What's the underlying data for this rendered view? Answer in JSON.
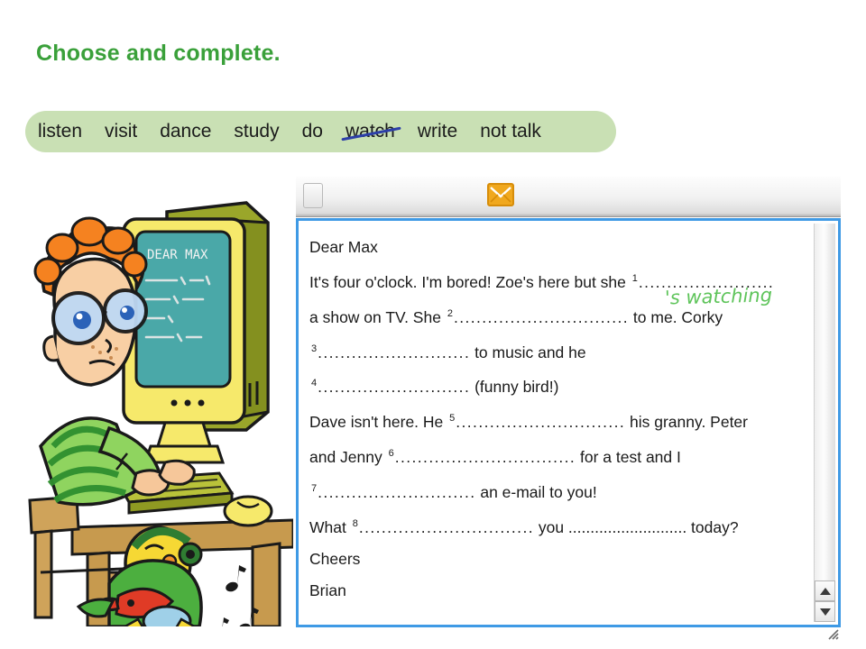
{
  "heading": "Choose and complete.",
  "colors": {
    "heading_green": "#3aa03a",
    "wordbank_bg": "#c9e0b4",
    "strike_blue": "#2d3fa8",
    "answer_green": "#5ec45a",
    "window_border_blue": "#3f9ae5",
    "envelope_orange": "#f0a81e"
  },
  "wordbank": {
    "words": [
      {
        "text": "listen",
        "struck": false
      },
      {
        "text": "visit",
        "struck": false
      },
      {
        "text": "dance",
        "struck": false
      },
      {
        "text": "study",
        "struck": false
      },
      {
        "text": "do",
        "struck": false
      },
      {
        "text": "watch",
        "struck": true
      },
      {
        "text": "write",
        "struck": false
      },
      {
        "text": "not talk",
        "struck": false
      }
    ]
  },
  "illustration": {
    "screen_text": "DEAR MAX",
    "alt": "Boy with orange hair and glasses typing an e-mail on a computer while two parrots listen to music"
  },
  "mail_window": {
    "toolbar": {
      "button_label": "",
      "envelope_icon": "envelope-icon"
    },
    "scrollbar": {
      "up_arrow": "scroll-up-arrow",
      "down_arrow": "scroll-down-arrow"
    },
    "body": {
      "filled_answer": "'s watching",
      "lines": [
        {
          "id": "l1",
          "pre": "Dear Max",
          "num": "",
          "dots": "",
          "post": ""
        },
        {
          "id": "l2",
          "pre": "It's four o'clock. I'm bored! Zoe's here but she ",
          "num": "1",
          "dots": "........................",
          "post": ""
        },
        {
          "id": "l3",
          "pre": "a show on TV. She ",
          "num": "2",
          "dots": "...............................",
          "post": " to me. Corky"
        },
        {
          "id": "l4",
          "pre": "",
          "num": "3",
          "dots": "...........................",
          "post": " to music and he"
        },
        {
          "id": "l5",
          "pre": "",
          "num": "4",
          "dots": "...........................",
          "post": " (funny bird!)"
        },
        {
          "id": "l6",
          "pre": "Dave isn't here. He ",
          "num": "5",
          "dots": "..............................",
          "post": " his granny. Peter"
        },
        {
          "id": "l7",
          "pre": "and Jenny ",
          "num": "6",
          "dots": "................................",
          "post": " for a test and I"
        },
        {
          "id": "l8",
          "pre": "",
          "num": "7",
          "dots": "............................",
          "post": " an e-mail to you!"
        },
        {
          "id": "l9",
          "pre": "What ",
          "num": "8",
          "dots": "...............................",
          "post": " you ........................... today?"
        },
        {
          "id": "l10",
          "pre": "Cheers",
          "num": "",
          "dots": "",
          "post": ""
        },
        {
          "id": "l11",
          "pre": "Brian",
          "num": "",
          "dots": "",
          "post": ""
        }
      ]
    }
  }
}
